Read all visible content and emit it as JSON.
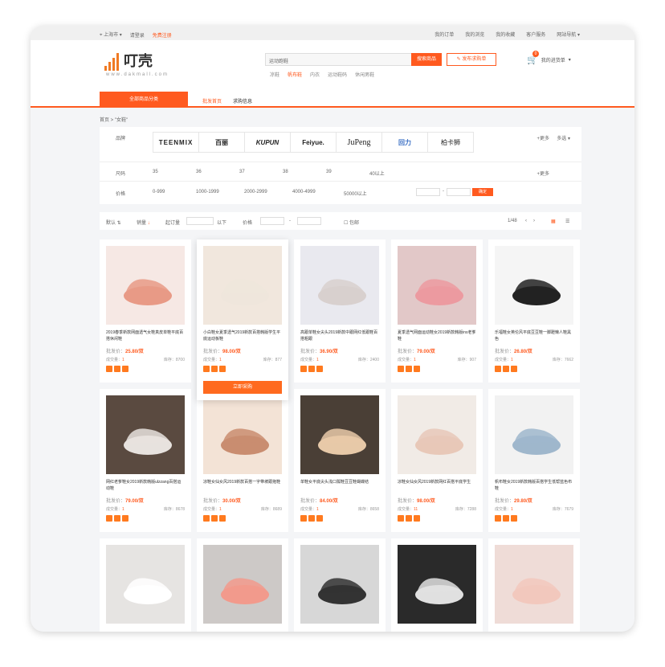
{
  "topbar": {
    "location": "上海市",
    "login": "请登录",
    "register": "免费注册",
    "links": [
      "我的订单",
      "我的浏览",
      "我的收藏",
      "客户服务",
      "网站导航"
    ]
  },
  "header": {
    "logo": "叮壳",
    "logo_url": "www.dakmall.com",
    "search_placeholder": "运动跑鞋",
    "search_button": "搜索商品",
    "publish_button": "发布求购单",
    "hot_words": [
      "凉鞋",
      "帆布鞋",
      "内衣",
      "运动鞋码",
      "休闲男鞋"
    ],
    "cart_count": "0",
    "cart_label": "我的进货单"
  },
  "nav": {
    "all_label": "全部商品分类",
    "items": [
      "批发首页",
      "求购信息"
    ]
  },
  "breadcrumb": "首页 > \"女鞋\"",
  "filter": {
    "brand_label": "品牌",
    "brands": [
      "TEENMIX",
      "百丽",
      "KUPUN",
      "Feiyue.",
      "JuPeng",
      "回力",
      "柏卡狮"
    ],
    "more": "+更多",
    "multi": "多选",
    "size_label": "尺码",
    "sizes": [
      "35",
      "36",
      "37",
      "38",
      "39",
      "40以上"
    ],
    "price_label": "价格",
    "prices": [
      "0-999",
      "1000-1999",
      "2000-2999",
      "4000-4999",
      "50000以上"
    ],
    "confirm": "确定"
  },
  "sortbar": {
    "default": "默认",
    "sales": "销量",
    "min_order": "起订量",
    "unit": "以下",
    "price": "价格",
    "sep": "-",
    "checkbox": "包邮",
    "page": "1/48"
  },
  "products": [
    {
      "title": "2019春季新款网面透气女鞋真皮单鞋平底百搭休闲鞋",
      "price": "25.80/双",
      "sales": "1",
      "stock": "8700",
      "bg": "#f6e8e4",
      "shoe": "#e89a86"
    },
    {
      "title": "小白鞋女夏季透气2019新款百搭韩版学生平底运动板鞋",
      "price": "98.00/双",
      "sales": "1",
      "stock": "877",
      "bg": "#f1e7dd",
      "shoe": "#efe6dc"
    },
    {
      "title": "高跟单鞋女尖头2019新款中跟网红低跟鞋百搭粗跟",
      "price": "36.90/双",
      "sales": "1",
      "stock": "2400",
      "bg": "#e9e9ef",
      "shoe": "#d8d0ce"
    },
    {
      "title": "夏季透气网面运动鞋女2019新款韩版ins老爹鞋",
      "price": "79.00/双",
      "sales": "1",
      "stock": "907",
      "bg": "#e2c8c8",
      "shoe": "#ec9aa0"
    },
    {
      "title": "乐福鞋女英伦风平底豆豆鞋一脚蹬懒人鞋黑色",
      "price": "26.80/双",
      "sales": "1",
      "stock": "7662",
      "bg": "#f5f5f5",
      "shoe": "#222222"
    },
    {
      "title": "网红老爹鞋女2019新款韩版ulzzang百搭运动鞋",
      "price": "79.00/双",
      "sales": "1",
      "stock": "8678",
      "bg": "#5a4a40",
      "shoe": "#e7e2de"
    },
    {
      "title": "凉鞋女仙女风2019新款百搭一字带坡跟拖鞋",
      "price": "30.00/双",
      "sales": "1",
      "stock": "8689",
      "bg": "#f3e3d6",
      "shoe": "#c98d70"
    },
    {
      "title": "单鞋女平底尖头浅口瓢鞋豆豆鞋蝴蝶结",
      "price": "84.00/双",
      "sales": "1",
      "stock": "8658",
      "bg": "#4a3f36",
      "shoe": "#e7c9a8"
    },
    {
      "title": "凉鞋女仙女风2019新款网红百搭平底学生",
      "price": "98.00/双",
      "sales": "11",
      "stock": "7288",
      "bg": "#f1ebe6",
      "shoe": "#e8c8b8"
    },
    {
      "title": "帆布鞋女2019新款韩版百搭学生低帮蓝色布鞋",
      "price": "29.80/双",
      "sales": "1",
      "stock": "7679",
      "bg": "#f2f2f2",
      "shoe": "#9fb7cc"
    },
    {
      "title": "",
      "price": "",
      "sales": "",
      "stock": "",
      "bg": "#e6e4e2",
      "shoe": "#ffffff"
    },
    {
      "title": "",
      "price": "",
      "sales": "",
      "stock": "",
      "bg": "#cdc9c7",
      "shoe": "#f29a8c"
    },
    {
      "title": "",
      "price": "",
      "sales": "",
      "stock": "",
      "bg": "#d7d7d7",
      "shoe": "#333333"
    },
    {
      "title": "",
      "price": "",
      "sales": "",
      "stock": "",
      "bg": "#2a2a2a",
      "shoe": "#e0e0e0"
    },
    {
      "title": "",
      "price": "",
      "sales": "",
      "stock": "",
      "bg": "#efdcd7",
      "shoe": "#f2c8bd"
    }
  ],
  "labels": {
    "price_prefix": "批发价：",
    "sales_prefix": "成交量：",
    "stock_prefix": "库存：",
    "buy_now": "立即采购"
  }
}
